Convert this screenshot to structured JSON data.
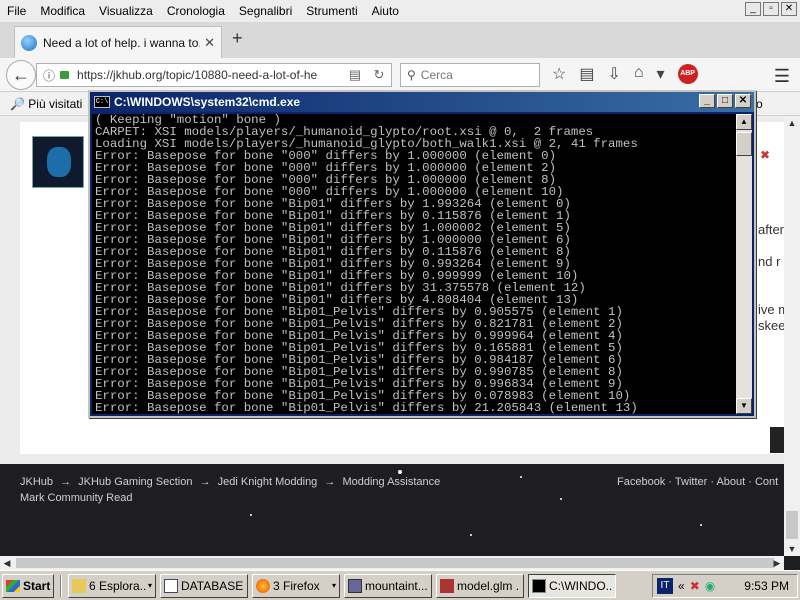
{
  "menubar": {
    "items": [
      "File",
      "Modifica",
      "Visualizza",
      "Cronologia",
      "Segnalibri",
      "Strumenti",
      "Aiuto"
    ]
  },
  "window_caps": [
    "_",
    "▫",
    "✕"
  ],
  "tab": {
    "title": "Need a lot of help. i wanna to...",
    "close": "✕",
    "new_tab": "+"
  },
  "nav": {
    "url": "https://jkhub.org/topic/10880-need-a-lot-of-he",
    "search_placeholder": "Cerca",
    "abp": "ABP"
  },
  "bookmarks": {
    "label": "Più visitati",
    "right": "o"
  },
  "page": {
    "partial_texts": [
      "after",
      "nd r",
      "ive m",
      "skee"
    ]
  },
  "cmd": {
    "title": "C:\\WINDOWS\\system32\\cmd.exe",
    "lines": [
      "( Keeping \"motion\" bone )",
      "CARPET: XSI models/players/_humanoid_glypto/root.xsi @ 0,  2 frames",
      "Loading XSI models/players/_humanoid_glypto/both_walk1.xsi @ 2, 41 frames",
      "Error: Basepose for bone \"000\" differs by 1.000000 (element 0)",
      "Error: Basepose for bone \"000\" differs by 1.000000 (element 2)",
      "Error: Basepose for bone \"000\" differs by 1.000000 (element 8)",
      "Error: Basepose for bone \"000\" differs by 1.000000 (element 10)",
      "Error: Basepose for bone \"Bip01\" differs by 1.993264 (element 0)",
      "Error: Basepose for bone \"Bip01\" differs by 0.115876 (element 1)",
      "Error: Basepose for bone \"Bip01\" differs by 1.000002 (element 5)",
      "Error: Basepose for bone \"Bip01\" differs by 1.000000 (element 6)",
      "Error: Basepose for bone \"Bip01\" differs by 0.115876 (element 8)",
      "Error: Basepose for bone \"Bip01\" differs by 0.993264 (element 9)",
      "Error: Basepose for bone \"Bip01\" differs by 0.999999 (element 10)",
      "Error: Basepose for bone \"Bip01\" differs by 31.375578 (element 12)",
      "Error: Basepose for bone \"Bip01\" differs by 4.808404 (element 13)",
      "Error: Basepose for bone \"Bip01_Pelvis\" differs by 0.905575 (element 1)",
      "Error: Basepose for bone \"Bip01_Pelvis\" differs by 0.821781 (element 2)",
      "Error: Basepose for bone \"Bip01_Pelvis\" differs by 0.999964 (element 4)",
      "Error: Basepose for bone \"Bip01_Pelvis\" differs by 0.165881 (element 5)",
      "Error: Basepose for bone \"Bip01_Pelvis\" differs by 0.984187 (element 6)",
      "Error: Basepose for bone \"Bip01_Pelvis\" differs by 0.990785 (element 8)",
      "Error: Basepose for bone \"Bip01_Pelvis\" differs by 0.996834 (element 9)",
      "Error: Basepose for bone \"Bip01_Pelvis\" differs by 0.078983 (element 10)",
      "Error: Basepose for bone \"Bip01_Pelvis\" differs by 21.205843 (element 13)"
    ]
  },
  "footer": {
    "crumbs": [
      "JKHub",
      "→",
      "JKHub Gaming Section",
      "→",
      "Jedi Knight Modding",
      "→",
      "Modding Assistance"
    ],
    "crumbs_row2": "Mark Community Read",
    "links": "Facebook · Twitter · About · Cont"
  },
  "taskbar": {
    "start": "Start",
    "tasks": [
      {
        "label": "6 Esplora...",
        "dropdown": "▾"
      },
      {
        "label": "DATABASE...",
        "dropdown": ""
      },
      {
        "label": "3 Firefox",
        "dropdown": "▾"
      },
      {
        "label": "mountaint...",
        "dropdown": ""
      },
      {
        "label": "model.glm ...",
        "dropdown": ""
      },
      {
        "label": "C:\\WINDO...",
        "dropdown": ""
      }
    ],
    "lang": "IT",
    "tray_arrows": "«",
    "clock": "9:53 PM"
  }
}
